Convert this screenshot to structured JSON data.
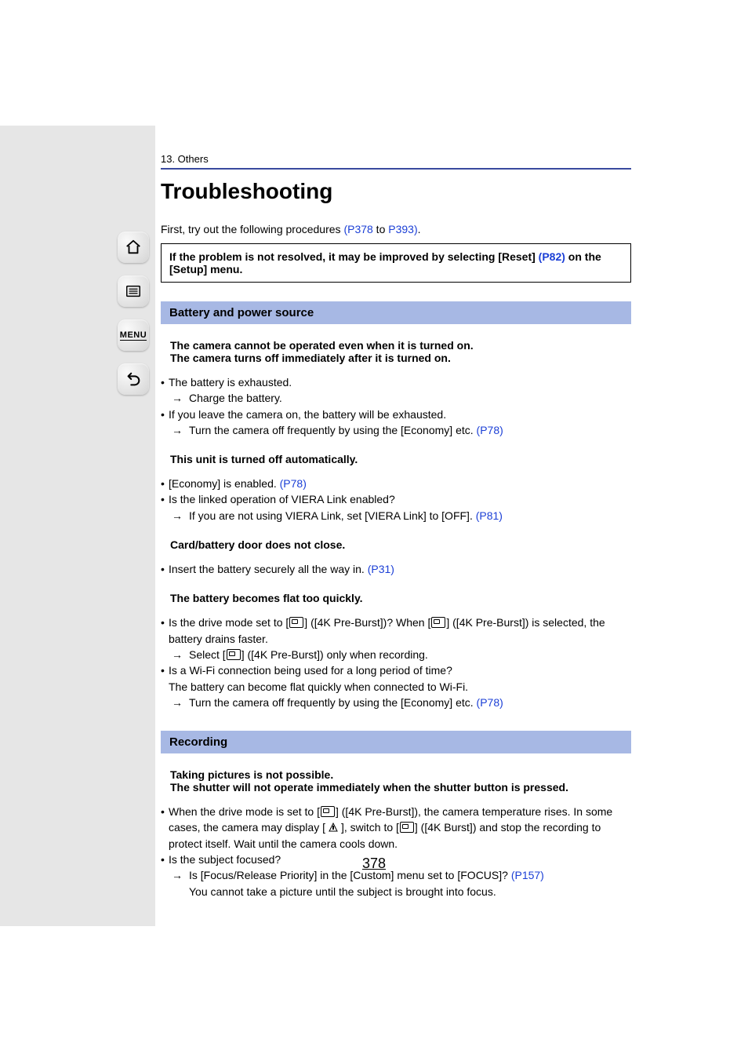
{
  "chapter": "13. Others",
  "title": "Troubleshooting",
  "intro_pre": "First, try out the following procedures ",
  "intro_link1": "(P378",
  "intro_mid": " to ",
  "intro_link2": "P393)",
  "intro_post": ".",
  "note_pre": "If the problem is not resolved, it may be improved by selecting [Reset] ",
  "note_link": "(P82)",
  "note_post": " on the [Setup] menu.",
  "section1": "Battery and power source",
  "t1_l1": "The camera cannot be operated even when it is turned on.",
  "t1_l2": "The camera turns off immediately after it is turned on.",
  "b1_1": "The battery is exhausted.",
  "b1_1s": "Charge the battery.",
  "b1_2": "If you leave the camera on, the battery will be exhausted.",
  "b1_2s_pre": "Turn the camera off frequently by using the [Economy] etc. ",
  "b1_2s_link": "(P78)",
  "t2": "This unit is turned off automatically.",
  "b2_1_pre": "[Economy] is enabled. ",
  "b2_1_link": "(P78)",
  "b2_2": "Is the linked operation of VIERA Link enabled?",
  "b2_2s_pre": "If you are not using VIERA Link, set [VIERA Link] to [OFF]. ",
  "b2_2s_link": "(P81)",
  "t3": "Card/battery door does not close.",
  "b3_1_pre": "Insert the battery securely all the way in. ",
  "b3_1_link": "(P31)",
  "t4": "The battery becomes flat too quickly.",
  "b4_1_pre": "Is the drive mode set to [",
  "b4_1_mid1": "] ([4K Pre-Burst])? When [",
  "b4_1_mid2": "] ([4K Pre-Burst]) is selected, the battery drains faster.",
  "b4_1s_pre": "Select [",
  "b4_1s_post": "] ([4K Pre-Burst]) only when recording.",
  "b4_2a": "Is a Wi-Fi connection being used for a long period of time?",
  "b4_2b": "The battery can become flat quickly when connected to Wi-Fi.",
  "b4_2s_pre": "Turn the camera off frequently by using the [Economy] etc. ",
  "b4_2s_link": "(P78)",
  "section2": "Recording",
  "t5_l1": "Taking pictures is not possible.",
  "t5_l2": "The shutter will not operate immediately when the shutter button is pressed.",
  "b5_1_pre": "When the drive mode is set to [",
  "b5_1_mid1": "] ([4K Pre-Burst]), the camera temperature rises. In some cases, the camera may display [",
  "b5_1_mid2": "], switch to [",
  "b5_1_mid3": "] ([4K Burst]) and stop the recording to protect itself. Wait until the camera cools down.",
  "b5_2": "Is the subject focused?",
  "b5_2s_pre": "Is [Focus/Release Priority] in the [Custom] menu set to [FOCUS]? ",
  "b5_2s_link": "(P157)",
  "b5_2s2": "You cannot take a picture until the subject is brought into focus.",
  "pagenum": "378"
}
